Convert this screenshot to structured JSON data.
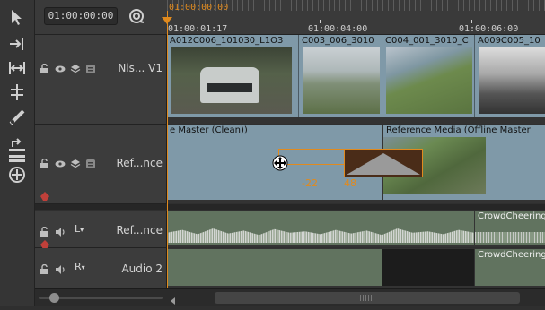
{
  "timeline": {
    "current_timecode": "01:00:00:00",
    "playhead_label": "01:00:00:00",
    "ruler_labels": [
      "01:00:01:17",
      "01:00:04:00",
      "01:00:06:00"
    ]
  },
  "tracks": {
    "v1": {
      "name": "Nis... V1"
    },
    "ref": {
      "name": "Ref...nce"
    },
    "a_ref": {
      "channel": "L",
      "name": "Ref...nce"
    },
    "a2": {
      "channel": "R",
      "name": "Audio 2"
    }
  },
  "clips": {
    "v1": [
      "A012C006_101030_L1O3",
      "C003_006_3010",
      "C004_001_3010_C",
      "A009C005_10"
    ],
    "ref_master": "e Master (Clean))",
    "ref_offline": "Reference Media (Offline Master",
    "audio_ref_right": "CrowdCheering",
    "audio2_right": "CrowdCheering"
  },
  "transition": {
    "left_offset": "-22",
    "right_offset": "48"
  },
  "colors": {
    "accent": "#e08a1e",
    "clip_video": "#7f99a8",
    "clip_audio": "#61735f",
    "panel": "#3c3c3c"
  },
  "icons": [
    "select-arrow-icon",
    "insert-icon",
    "slip-icon",
    "slide-icon",
    "razor-icon",
    "lift-icon",
    "overwrite-icon",
    "snap-icon",
    "lock-icon",
    "eye-icon",
    "layers-icon",
    "clip-stack-icon",
    "speaker-icon",
    "record-indicator-icon",
    "move-cursor-icon"
  ]
}
